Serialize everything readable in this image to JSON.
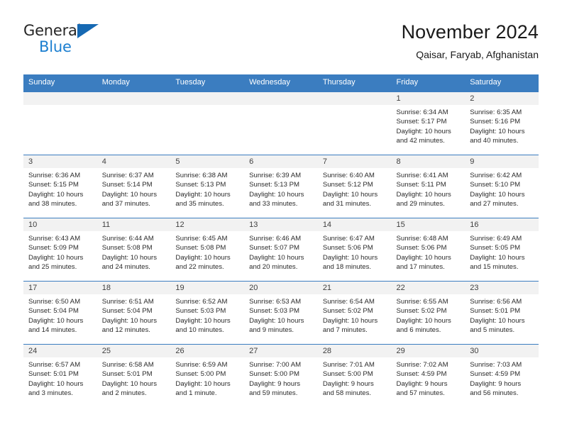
{
  "brand": {
    "name_part1": "General",
    "name_part2": "Blue"
  },
  "header": {
    "title": "November 2024",
    "subtitle": "Qaisar, Faryab, Afghanistan"
  },
  "weekdays": [
    "Sunday",
    "Monday",
    "Tuesday",
    "Wednesday",
    "Thursday",
    "Friday",
    "Saturday"
  ],
  "colors": {
    "header_blue": "#3b7dc0",
    "brand_blue": "#1c7fd0",
    "daynum_band": "#f2f2f2",
    "text": "#2b2b2b"
  },
  "weeks": [
    [
      {
        "day": "",
        "sunrise": "",
        "sunset": "",
        "daylight1": "",
        "daylight2": ""
      },
      {
        "day": "",
        "sunrise": "",
        "sunset": "",
        "daylight1": "",
        "daylight2": ""
      },
      {
        "day": "",
        "sunrise": "",
        "sunset": "",
        "daylight1": "",
        "daylight2": ""
      },
      {
        "day": "",
        "sunrise": "",
        "sunset": "",
        "daylight1": "",
        "daylight2": ""
      },
      {
        "day": "",
        "sunrise": "",
        "sunset": "",
        "daylight1": "",
        "daylight2": ""
      },
      {
        "day": "1",
        "sunrise": "Sunrise: 6:34 AM",
        "sunset": "Sunset: 5:17 PM",
        "daylight1": "Daylight: 10 hours",
        "daylight2": "and 42 minutes."
      },
      {
        "day": "2",
        "sunrise": "Sunrise: 6:35 AM",
        "sunset": "Sunset: 5:16 PM",
        "daylight1": "Daylight: 10 hours",
        "daylight2": "and 40 minutes."
      }
    ],
    [
      {
        "day": "3",
        "sunrise": "Sunrise: 6:36 AM",
        "sunset": "Sunset: 5:15 PM",
        "daylight1": "Daylight: 10 hours",
        "daylight2": "and 38 minutes."
      },
      {
        "day": "4",
        "sunrise": "Sunrise: 6:37 AM",
        "sunset": "Sunset: 5:14 PM",
        "daylight1": "Daylight: 10 hours",
        "daylight2": "and 37 minutes."
      },
      {
        "day": "5",
        "sunrise": "Sunrise: 6:38 AM",
        "sunset": "Sunset: 5:13 PM",
        "daylight1": "Daylight: 10 hours",
        "daylight2": "and 35 minutes."
      },
      {
        "day": "6",
        "sunrise": "Sunrise: 6:39 AM",
        "sunset": "Sunset: 5:13 PM",
        "daylight1": "Daylight: 10 hours",
        "daylight2": "and 33 minutes."
      },
      {
        "day": "7",
        "sunrise": "Sunrise: 6:40 AM",
        "sunset": "Sunset: 5:12 PM",
        "daylight1": "Daylight: 10 hours",
        "daylight2": "and 31 minutes."
      },
      {
        "day": "8",
        "sunrise": "Sunrise: 6:41 AM",
        "sunset": "Sunset: 5:11 PM",
        "daylight1": "Daylight: 10 hours",
        "daylight2": "and 29 minutes."
      },
      {
        "day": "9",
        "sunrise": "Sunrise: 6:42 AM",
        "sunset": "Sunset: 5:10 PM",
        "daylight1": "Daylight: 10 hours",
        "daylight2": "and 27 minutes."
      }
    ],
    [
      {
        "day": "10",
        "sunrise": "Sunrise: 6:43 AM",
        "sunset": "Sunset: 5:09 PM",
        "daylight1": "Daylight: 10 hours",
        "daylight2": "and 25 minutes."
      },
      {
        "day": "11",
        "sunrise": "Sunrise: 6:44 AM",
        "sunset": "Sunset: 5:08 PM",
        "daylight1": "Daylight: 10 hours",
        "daylight2": "and 24 minutes."
      },
      {
        "day": "12",
        "sunrise": "Sunrise: 6:45 AM",
        "sunset": "Sunset: 5:08 PM",
        "daylight1": "Daylight: 10 hours",
        "daylight2": "and 22 minutes."
      },
      {
        "day": "13",
        "sunrise": "Sunrise: 6:46 AM",
        "sunset": "Sunset: 5:07 PM",
        "daylight1": "Daylight: 10 hours",
        "daylight2": "and 20 minutes."
      },
      {
        "day": "14",
        "sunrise": "Sunrise: 6:47 AM",
        "sunset": "Sunset: 5:06 PM",
        "daylight1": "Daylight: 10 hours",
        "daylight2": "and 18 minutes."
      },
      {
        "day": "15",
        "sunrise": "Sunrise: 6:48 AM",
        "sunset": "Sunset: 5:06 PM",
        "daylight1": "Daylight: 10 hours",
        "daylight2": "and 17 minutes."
      },
      {
        "day": "16",
        "sunrise": "Sunrise: 6:49 AM",
        "sunset": "Sunset: 5:05 PM",
        "daylight1": "Daylight: 10 hours",
        "daylight2": "and 15 minutes."
      }
    ],
    [
      {
        "day": "17",
        "sunrise": "Sunrise: 6:50 AM",
        "sunset": "Sunset: 5:04 PM",
        "daylight1": "Daylight: 10 hours",
        "daylight2": "and 14 minutes."
      },
      {
        "day": "18",
        "sunrise": "Sunrise: 6:51 AM",
        "sunset": "Sunset: 5:04 PM",
        "daylight1": "Daylight: 10 hours",
        "daylight2": "and 12 minutes."
      },
      {
        "day": "19",
        "sunrise": "Sunrise: 6:52 AM",
        "sunset": "Sunset: 5:03 PM",
        "daylight1": "Daylight: 10 hours",
        "daylight2": "and 10 minutes."
      },
      {
        "day": "20",
        "sunrise": "Sunrise: 6:53 AM",
        "sunset": "Sunset: 5:03 PM",
        "daylight1": "Daylight: 10 hours",
        "daylight2": "and 9 minutes."
      },
      {
        "day": "21",
        "sunrise": "Sunrise: 6:54 AM",
        "sunset": "Sunset: 5:02 PM",
        "daylight1": "Daylight: 10 hours",
        "daylight2": "and 7 minutes."
      },
      {
        "day": "22",
        "sunrise": "Sunrise: 6:55 AM",
        "sunset": "Sunset: 5:02 PM",
        "daylight1": "Daylight: 10 hours",
        "daylight2": "and 6 minutes."
      },
      {
        "day": "23",
        "sunrise": "Sunrise: 6:56 AM",
        "sunset": "Sunset: 5:01 PM",
        "daylight1": "Daylight: 10 hours",
        "daylight2": "and 5 minutes."
      }
    ],
    [
      {
        "day": "24",
        "sunrise": "Sunrise: 6:57 AM",
        "sunset": "Sunset: 5:01 PM",
        "daylight1": "Daylight: 10 hours",
        "daylight2": "and 3 minutes."
      },
      {
        "day": "25",
        "sunrise": "Sunrise: 6:58 AM",
        "sunset": "Sunset: 5:01 PM",
        "daylight1": "Daylight: 10 hours",
        "daylight2": "and 2 minutes."
      },
      {
        "day": "26",
        "sunrise": "Sunrise: 6:59 AM",
        "sunset": "Sunset: 5:00 PM",
        "daylight1": "Daylight: 10 hours",
        "daylight2": "and 1 minute."
      },
      {
        "day": "27",
        "sunrise": "Sunrise: 7:00 AM",
        "sunset": "Sunset: 5:00 PM",
        "daylight1": "Daylight: 9 hours",
        "daylight2": "and 59 minutes."
      },
      {
        "day": "28",
        "sunrise": "Sunrise: 7:01 AM",
        "sunset": "Sunset: 5:00 PM",
        "daylight1": "Daylight: 9 hours",
        "daylight2": "and 58 minutes."
      },
      {
        "day": "29",
        "sunrise": "Sunrise: 7:02 AM",
        "sunset": "Sunset: 4:59 PM",
        "daylight1": "Daylight: 9 hours",
        "daylight2": "and 57 minutes."
      },
      {
        "day": "30",
        "sunrise": "Sunrise: 7:03 AM",
        "sunset": "Sunset: 4:59 PM",
        "daylight1": "Daylight: 9 hours",
        "daylight2": "and 56 minutes."
      }
    ]
  ]
}
